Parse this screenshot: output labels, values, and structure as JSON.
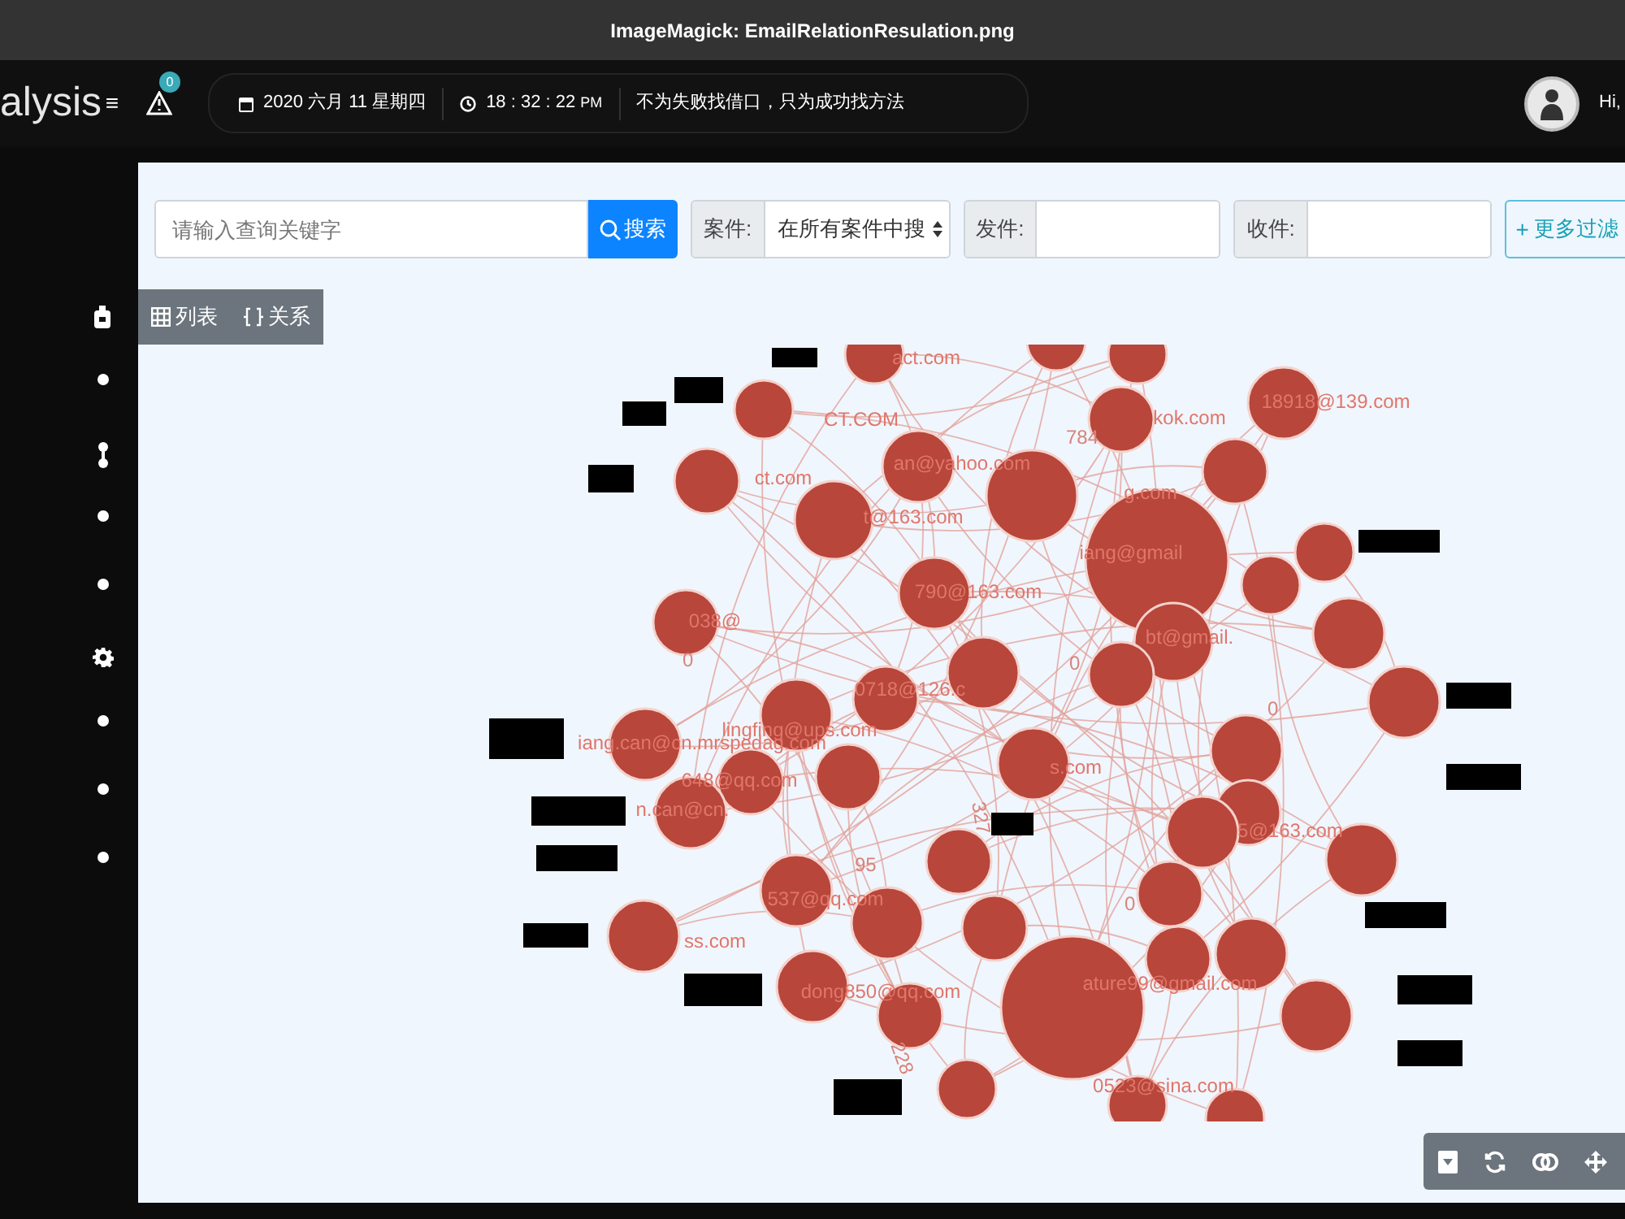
{
  "window": {
    "title": "ImageMagick: EmailRelationResulation.png"
  },
  "header": {
    "logo": "alysis",
    "menu_icon": "≡",
    "alert_count": "0",
    "date": "2020 六月 11 星期四",
    "time": "18 : 32 : 22",
    "time_suffix": "PM",
    "motto": "不为失败找借口，只为成功找方法",
    "greeting": "Hi,"
  },
  "sidebar": {
    "items": [
      {
        "kind": "bag"
      },
      {
        "kind": "dot"
      },
      {
        "kind": "link"
      },
      {
        "kind": "dot"
      },
      {
        "kind": "dot"
      },
      {
        "kind": "gear"
      },
      {
        "kind": "dot"
      },
      {
        "kind": "dot"
      },
      {
        "kind": "dot"
      }
    ]
  },
  "search": {
    "placeholder": "请输入查询关键字",
    "button": "搜索"
  },
  "filters": [
    {
      "kind": "select",
      "label": "案件:",
      "value": "在所有案件中搜"
    },
    {
      "kind": "input",
      "label": "发件:"
    },
    {
      "kind": "input",
      "label": "收件:"
    }
  ],
  "more_filter": {
    "icon": "+",
    "label": "更多过滤"
  },
  "view_tabs": [
    {
      "kind": "table",
      "label": "列表"
    },
    {
      "kind": "relation",
      "label": "关系"
    }
  ],
  "graph": {
    "node_labels": [
      "act.com",
      "CT.COM",
      "an@yahoo.com",
      "kok.com",
      "18918@139.com",
      "ct.com",
      "t@163.com",
      "g.com",
      "iang@gmail",
      "790@163.com",
      "038@",
      "bt@gmail.",
      "0718@126.c",
      "lingfing@ups.com",
      "iang.can@cn.mrspedag.com",
      "648@qq.com",
      "s.com",
      "n.can@cn.",
      "5@163.com",
      "537@qq.com",
      "ss.com",
      "dong850@qq.com",
      "ature99@gmail.com",
      "0523@sina.com"
    ],
    "edge_labels": [
      "784",
      "0",
      "0",
      "0",
      "327",
      "95",
      "228",
      "0"
    ]
  },
  "toolbar": [
    {
      "kind": "download"
    },
    {
      "kind": "refresh"
    },
    {
      "kind": "toggle"
    },
    {
      "kind": "move"
    }
  ]
}
